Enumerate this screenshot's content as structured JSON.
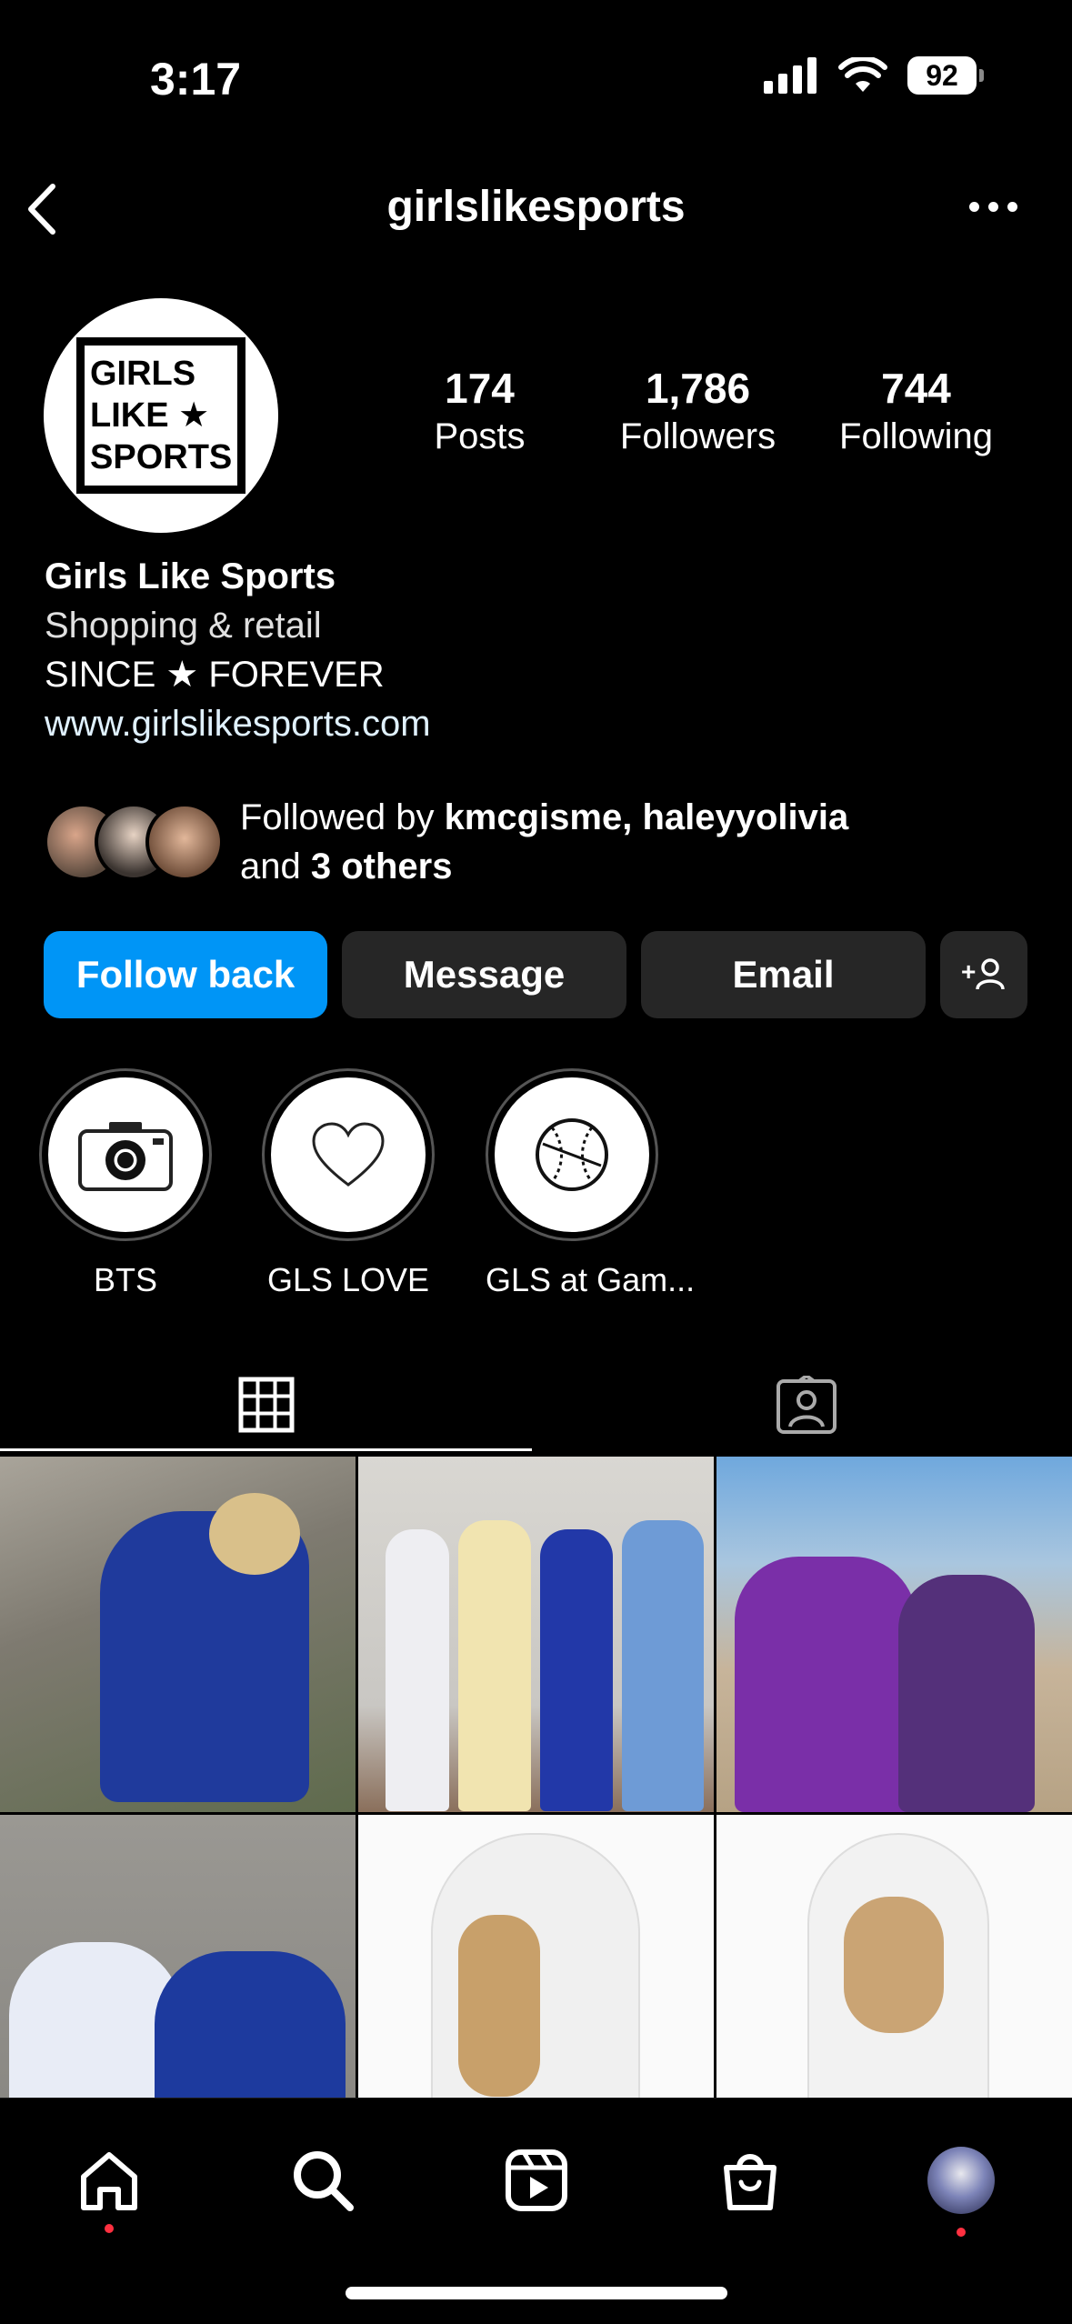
{
  "status_bar": {
    "time": "3:17",
    "battery": "92"
  },
  "header": {
    "title": "girlslikesports"
  },
  "profile": {
    "logo_lines": [
      "GIRLS",
      "LIKE ★",
      "SPORTS"
    ],
    "stats": [
      {
        "value": "174",
        "label": "Posts"
      },
      {
        "value": "1,786",
        "label": "Followers"
      },
      {
        "value": "744",
        "label": "Following"
      }
    ],
    "name": "Girls Like Sports",
    "category": "Shopping & retail",
    "tagline": "SINCE ★ FOREVER",
    "website": "www.girlslikesports.com",
    "followed_by": {
      "prefix": "Followed by ",
      "users": "kmcgisme, haleyyolivia",
      "and": "and ",
      "others": "3 others"
    }
  },
  "actions": {
    "follow_back": "Follow back",
    "message": "Message",
    "email": "Email"
  },
  "highlights": [
    {
      "label": "BTS",
      "icon": "camera-icon"
    },
    {
      "label": "GLS LOVE",
      "icon": "heart-icon"
    },
    {
      "label": "GLS at Gam...",
      "icon": "baseball-icon"
    }
  ],
  "tabs": [
    {
      "icon": "grid-icon"
    },
    {
      "icon": "tagged-icon"
    }
  ],
  "colors": {
    "accent": "#0095f6",
    "button": "#262626",
    "notification": "#ff3040"
  },
  "nav": [
    {
      "icon": "home-icon"
    },
    {
      "icon": "search-icon"
    },
    {
      "icon": "reels-icon"
    },
    {
      "icon": "shop-icon"
    },
    {
      "icon": "profile-avatar"
    }
  ]
}
